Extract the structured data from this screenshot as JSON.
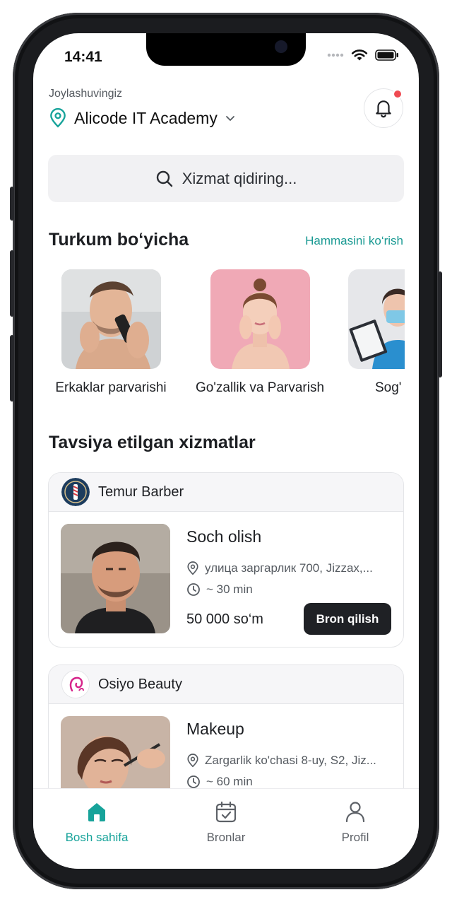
{
  "status": {
    "time": "14:41"
  },
  "location": {
    "label": "Joylashuvingiz",
    "name": "Alicode IT Academy"
  },
  "search": {
    "placeholder": "Xizmat qidiring..."
  },
  "categories_section": {
    "title": "Turkum bo‘yicha",
    "see_all": "Hammasini ko‘rish",
    "items": [
      {
        "label": "Erkaklar parvarishi"
      },
      {
        "label": "Go'zallik va Parvarish"
      },
      {
        "label": "Sog'"
      }
    ]
  },
  "recommended_section": {
    "title": "Tavsiya etilgan xizmatlar",
    "cards": [
      {
        "shop": "Temur Barber",
        "service": "Soch olish",
        "address": "улица заргарлик 700, Jizzax,...",
        "duration": "~ 30 min",
        "price": "50 000 so‘m",
        "button": "Bron qilish"
      },
      {
        "shop": "Osiyo Beauty",
        "service": "Makeup",
        "address": "Zargarlik ko'chasi 8-uy, S2, Jiz...",
        "duration": "~ 60 min"
      }
    ]
  },
  "tabbar": {
    "items": [
      {
        "label": "Bosh sahifa",
        "icon": "home-icon",
        "active": true
      },
      {
        "label": "Bronlar",
        "icon": "calendar-icon",
        "active": false
      },
      {
        "label": "Profil",
        "icon": "user-icon",
        "active": false
      }
    ]
  },
  "colors": {
    "accent": "#17a39a",
    "notification": "#ef4a52",
    "button": "#1f2125"
  }
}
